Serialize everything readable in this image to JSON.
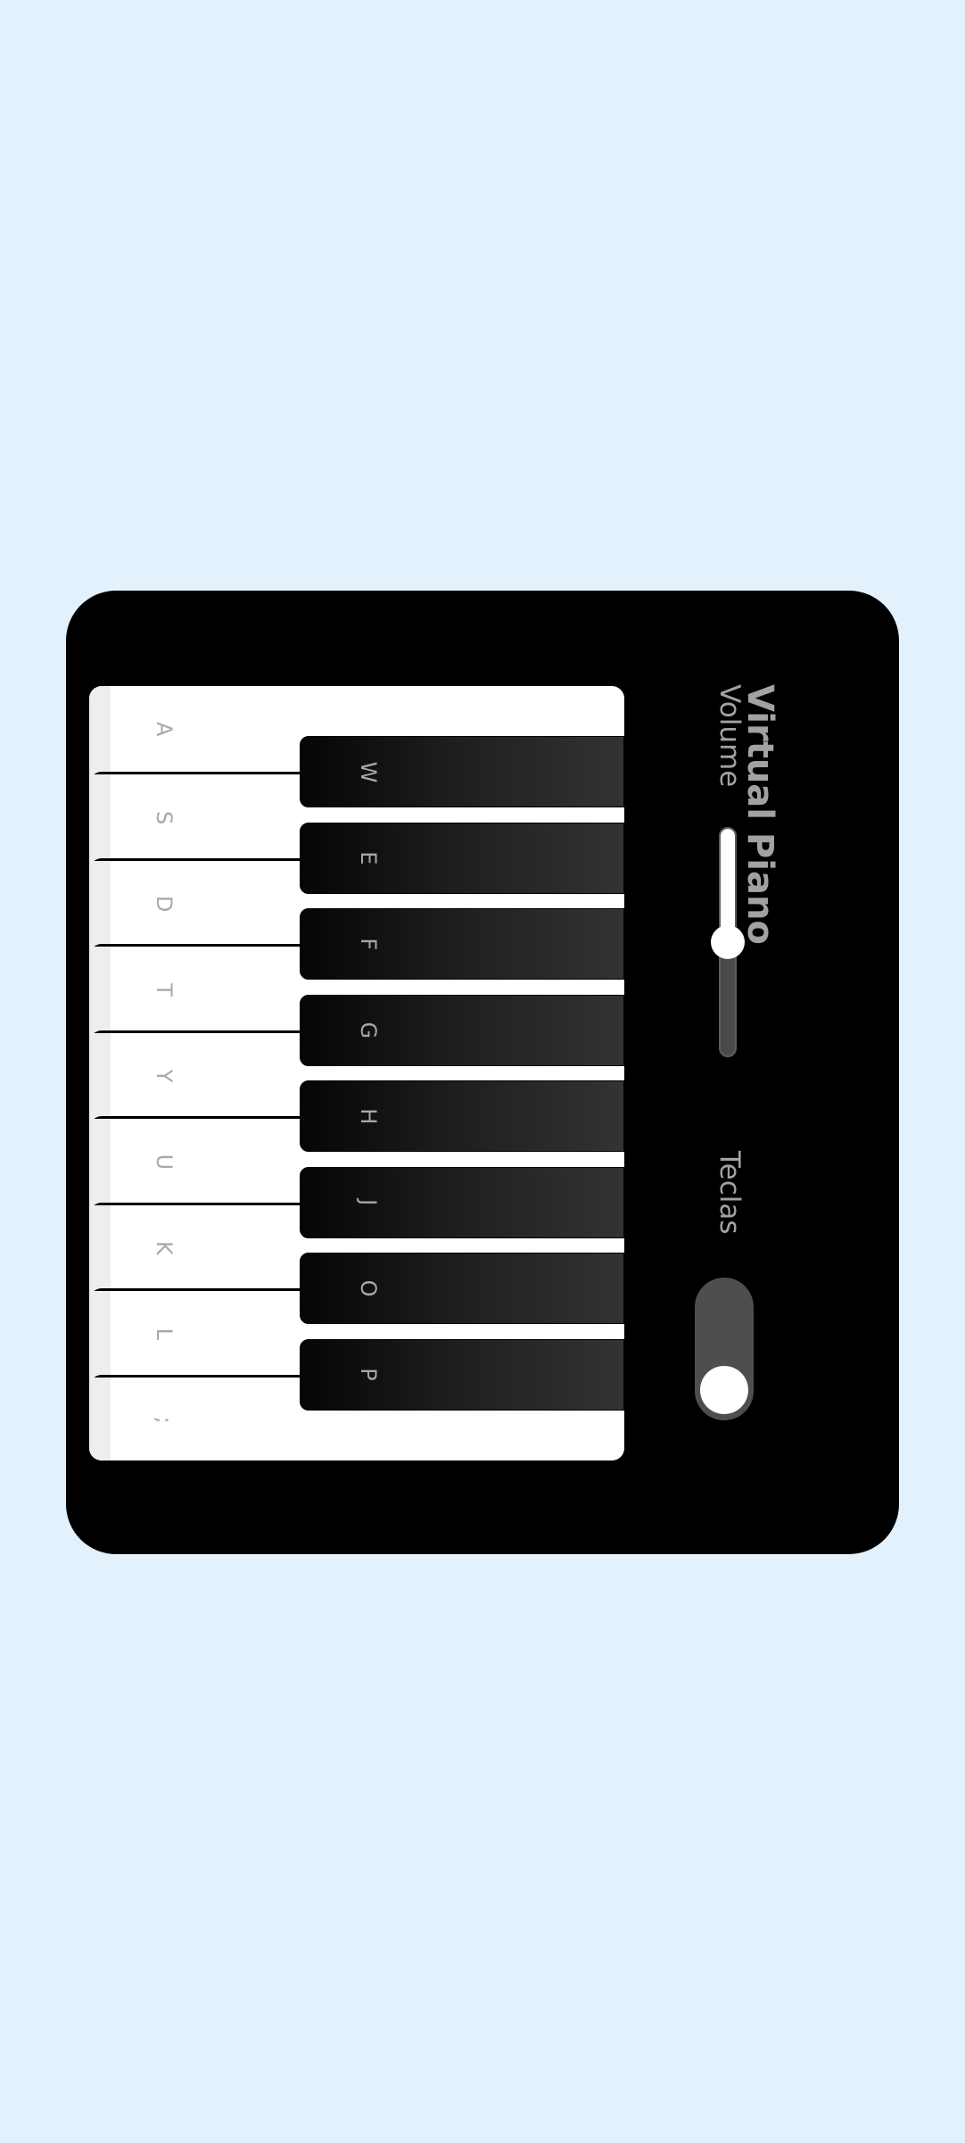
{
  "header": {
    "title": "Virtual Piano",
    "volume_label": "Volume",
    "keys_label": "Teclas"
  },
  "volume": {
    "value_fraction": 0.5
  },
  "keys_toggle": {
    "on": false
  },
  "keyboard": {
    "white_keys": [
      "A",
      "S",
      "D",
      "T",
      "Y",
      "U",
      "K",
      "L",
      ";"
    ],
    "black_keys": [
      "W",
      "E",
      "F",
      "G",
      "H",
      "J",
      "O",
      "P"
    ]
  },
  "colors": {
    "page_background": "#e3f1fc",
    "panel": "#000000",
    "label_gray": "#a2a2a2",
    "toggle_track": "#4e4e4e"
  }
}
